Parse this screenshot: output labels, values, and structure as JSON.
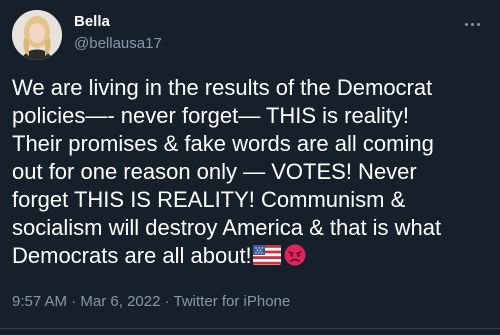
{
  "tweet": {
    "author": {
      "display_name": "Bella",
      "handle": "@bellausa17"
    },
    "text_lines": [
      "We are living in the results of the Democrat",
      "policies—- never forget— THIS is reality!",
      "Their promises & fake words are all coming",
      "out for one reason only — VOTES! Never",
      "forget THIS IS REALITY! Communism &",
      "socialism will destroy America & that is what",
      "Democrats are all about!"
    ],
    "emojis": [
      "us-flag-icon",
      "angry-face-icon"
    ],
    "time": "9:57 AM",
    "separator": "·",
    "date": "Mar 6, 2022",
    "source": "Twitter for iPhone"
  },
  "colors": {
    "background": "#15202b",
    "text_primary": "#ffffff",
    "text_secondary": "#8899a6",
    "angry_emoji": "#e0245e"
  }
}
